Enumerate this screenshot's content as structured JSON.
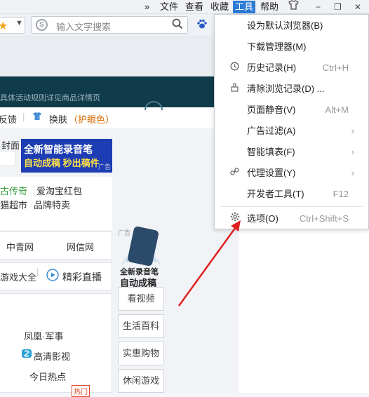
{
  "menubar": {
    "chevron": "»",
    "items": [
      "文件",
      "查看",
      "收藏",
      "工具",
      "帮助"
    ],
    "tshirt_icon": "tshirt-icon",
    "minimize": "−",
    "restore": "❐",
    "close": "✕"
  },
  "toolbar": {
    "search_placeholder": "输入文字搜索"
  },
  "banner": {
    "text": "具体活动规则详见商品详情页"
  },
  "line2": {
    "feedback": "反馈",
    "skin": "换肤",
    "eye_care": "（护眼色）"
  },
  "content": {
    "cover_label": "封面",
    "ad_line1": "全新智能录音笔",
    "ad_line2": "自动成稿 秒出稿件",
    "ad_tag": "广告",
    "links_row1": [
      "古传奇",
      "爱淘宝红包"
    ],
    "links_row2": [
      "猫超市",
      "品牌特卖"
    ],
    "links_row3": [
      "中青网",
      "网信网"
    ],
    "games": "游戏大全",
    "live": "精彩直播",
    "news": [
      "凤凰·军事",
      "高清影视",
      "今日热点"
    ],
    "hot_tag": "热门",
    "robot_tag": "广告",
    "robot_line1": "全新录音笔",
    "robot_line2": "自动成稿"
  },
  "side_buttons": [
    "看视频",
    "生活百科",
    "实惠购物",
    "休闲游戏"
  ],
  "dropdown": {
    "items": [
      {
        "label": "设为默认浏览器(B)",
        "shortcut": "",
        "icon": ""
      },
      {
        "label": "下载管理器(M)",
        "shortcut": "",
        "icon": ""
      },
      {
        "label": "历史记录(H)",
        "shortcut": "Ctrl+H",
        "icon": "history-icon"
      },
      {
        "label": "清除浏览记录(D) ...",
        "shortcut": "",
        "icon": "clear-history-icon"
      },
      {
        "label": "页面静音(V)",
        "shortcut": "Alt+M",
        "icon": ""
      },
      {
        "label": "广告过滤(A)",
        "shortcut": "",
        "icon": "",
        "submenu": true
      },
      {
        "label": "智能填表(F)",
        "shortcut": "",
        "icon": "",
        "submenu": true
      },
      {
        "label": "代理设置(Y)",
        "shortcut": "",
        "icon": "proxy-link-icon",
        "submenu": true
      },
      {
        "label": "开发者工具(T)",
        "shortcut": "F12",
        "icon": ""
      },
      {
        "label": "选项(O)",
        "shortcut": "Ctrl+Shift+S",
        "icon": "gear-icon"
      }
    ]
  },
  "colors": {
    "accent": "#2d7bd6",
    "banner": "#0f3b4a",
    "ad_blue": "#1c3db3",
    "arrow_red": "#e02020"
  }
}
